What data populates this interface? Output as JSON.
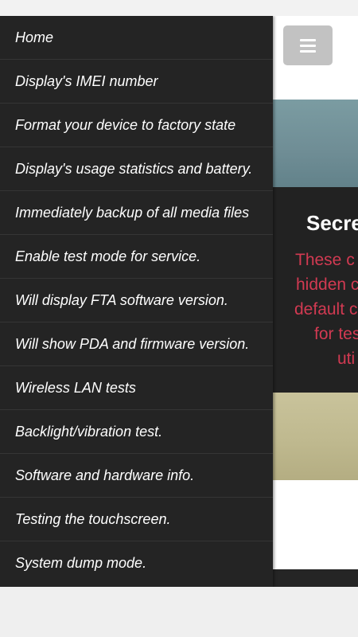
{
  "drawer": {
    "items": [
      {
        "label": "Home"
      },
      {
        "label": "Display's IMEI number"
      },
      {
        "label": "Format your device to factory state"
      },
      {
        "label": "Display's usage statistics and battery."
      },
      {
        "label": "Immediately backup of all media files"
      },
      {
        "label": "Enable test mode for service."
      },
      {
        "label": "Will display FTA software version."
      },
      {
        "label": "Will show PDA and firmware version."
      },
      {
        "label": "Wireless LAN tests"
      },
      {
        "label": "Backlight/vibration test."
      },
      {
        "label": "Software and hardware info."
      },
      {
        "label": "Testing the touchscreen."
      },
      {
        "label": "System dump mode."
      }
    ]
  },
  "main": {
    "menu_icon": "hamburger-icon",
    "panel": {
      "title": "Secre",
      "lines": [
        "These c",
        "hidden c",
        "default c",
        "for tes",
        "uti"
      ]
    }
  },
  "colors": {
    "drawer_bg": "#242424",
    "panel_bg": "#222222",
    "panel_text": "#d23a52",
    "menu_button": "#c2c2c2"
  }
}
